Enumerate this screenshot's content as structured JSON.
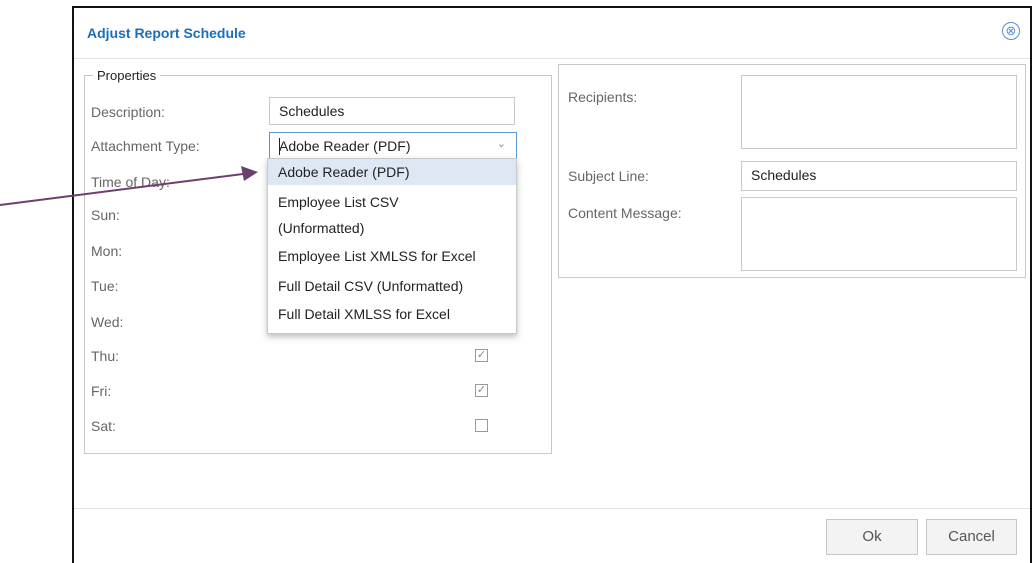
{
  "dialog": {
    "title": "Adjust Report Schedule",
    "close_icon": "⊗"
  },
  "properties": {
    "legend": "Properties",
    "description_label": "Description:",
    "description_value": "Schedules",
    "attachment_label": "Attachment Type:",
    "attachment_value": "Adobe Reader (PDF)",
    "time_label": "Time of Day:",
    "days": [
      {
        "label": "Sun:",
        "checked": null
      },
      {
        "label": "Mon:",
        "checked": null
      },
      {
        "label": "Tue:",
        "checked": null
      },
      {
        "label": "Wed:",
        "checked": null
      },
      {
        "label": "Thu:",
        "checked": true
      },
      {
        "label": "Fri:",
        "checked": true
      },
      {
        "label": "Sat:",
        "checked": false
      }
    ]
  },
  "dropdown": {
    "options": [
      "Adobe Reader (PDF)",
      "Employee List CSV",
      "(Unformatted)",
      "Employee List XMLSS for Excel",
      "Full Detail CSV (Unformatted)",
      "Full Detail XMLSS for Excel"
    ],
    "selected": "Adobe Reader (PDF)"
  },
  "email": {
    "recipients_label": "Recipients:",
    "recipients_value": "",
    "subject_label": "Subject Line:",
    "subject_value": "Schedules",
    "content_label": "Content Message:",
    "content_value": ""
  },
  "footer": {
    "ok_label": "Ok",
    "cancel_label": "Cancel"
  },
  "colors": {
    "title": "#1c6ebd",
    "arrow": "#6e3f6e",
    "selected_option": "#dde8f4"
  }
}
